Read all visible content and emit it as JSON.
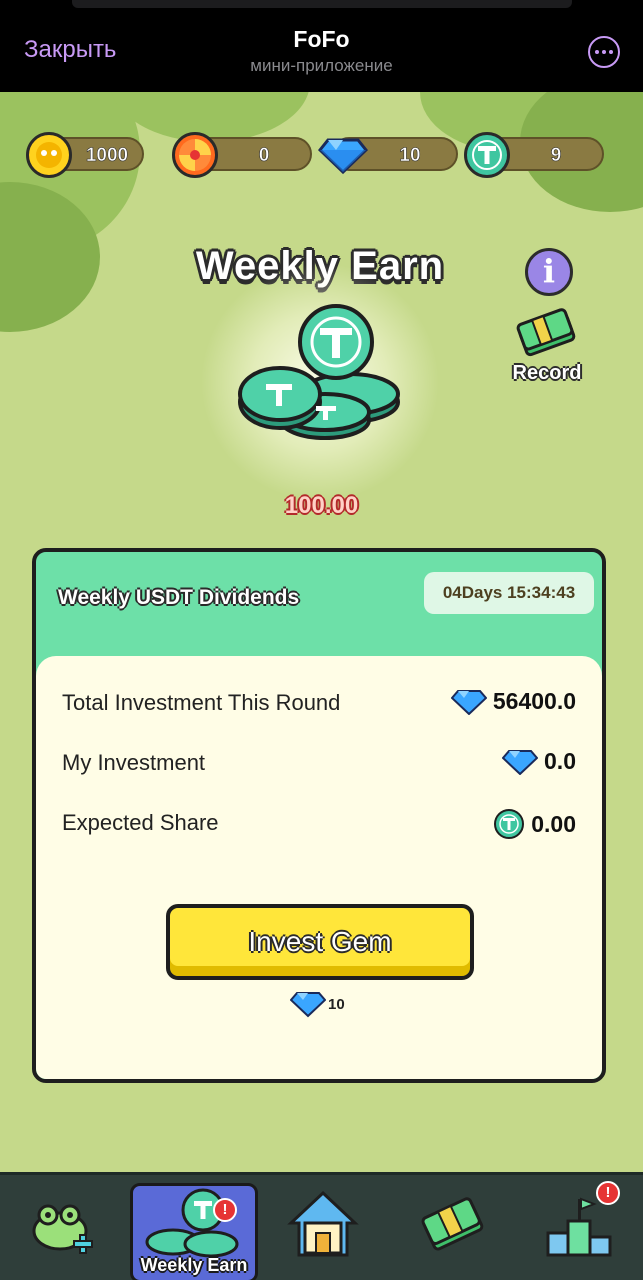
{
  "telegram": {
    "close_label": "Закрыть",
    "app_title": "FoFo",
    "app_subtitle": "мини-приложение"
  },
  "resources": [
    {
      "name": "coins",
      "icon": "gold-coin-icon",
      "value": "1000"
    },
    {
      "name": "candy",
      "icon": "candy-icon",
      "value": "0"
    },
    {
      "name": "gems",
      "icon": "diamond-icon",
      "value": "10"
    },
    {
      "name": "usdt",
      "icon": "usdt-icon",
      "value": "9"
    }
  ],
  "page": {
    "title": "Weekly Earn",
    "info_icon": "info-icon",
    "record_label": "Record",
    "reward_amount": "100.00"
  },
  "card": {
    "title": "Weekly USDT Dividends",
    "timer": "04Days 15:34:43",
    "rows": [
      {
        "label": "Total Investment This Round",
        "value": "56400.0",
        "icon": "diamond-icon"
      },
      {
        "label": "My Investment",
        "value": "0.0",
        "icon": "diamond-icon"
      },
      {
        "label": "Expected Share",
        "value": "0.00",
        "icon": "usdt-icon"
      }
    ],
    "invest_button": "Invest Gem",
    "invest_cost": "10"
  },
  "nav": {
    "items": [
      {
        "name": "frog",
        "icon": "frog-icon",
        "label": ""
      },
      {
        "name": "weekly-earn",
        "icon": "usdt-stack-icon",
        "label": "Weekly Earn",
        "badge": "!"
      },
      {
        "name": "home",
        "icon": "home-icon",
        "label": ""
      },
      {
        "name": "cash",
        "icon": "money-icon",
        "label": ""
      },
      {
        "name": "leaderboard",
        "icon": "podium-icon",
        "label": "",
        "badge": "!"
      }
    ]
  },
  "colors": {
    "accent": "#c89af5",
    "card_green": "#6de0a8",
    "button_yellow": "#ffe63a",
    "nav_active": "#5a6ad7"
  }
}
